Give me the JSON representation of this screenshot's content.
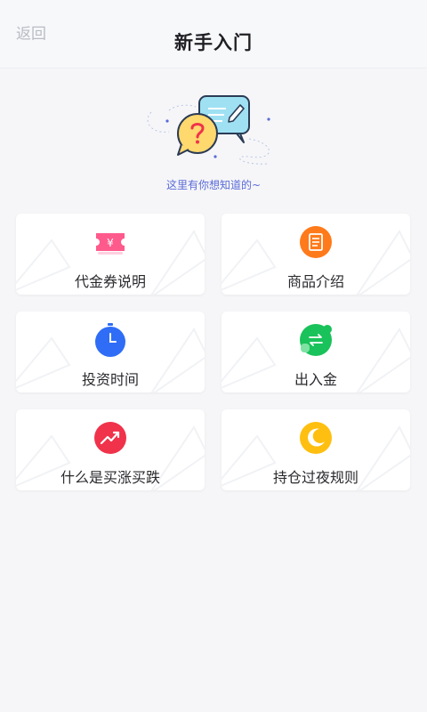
{
  "header": {
    "back_label": "返回",
    "title": "新手入门"
  },
  "hero": {
    "subtitle": "这里有你想知道的~"
  },
  "cards": [
    {
      "label": "代金券说明",
      "icon": "voucher-icon",
      "color": "#ff5a8c"
    },
    {
      "label": "商品介绍",
      "icon": "document-icon",
      "color": "#ff7a1a"
    },
    {
      "label": "投资时间",
      "icon": "stopwatch-icon",
      "color": "#2f6df6"
    },
    {
      "label": "出入金",
      "icon": "transfer-icon",
      "color": "#19c25a"
    },
    {
      "label": "什么是买涨买跌",
      "icon": "trend-up-icon",
      "color": "#f0324a"
    },
    {
      "label": "持仓过夜规则",
      "icon": "moon-icon",
      "color": "#ffbf10"
    }
  ]
}
